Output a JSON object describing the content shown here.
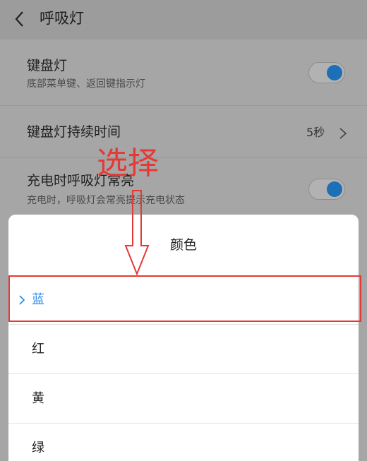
{
  "header": {
    "title": "呼吸灯"
  },
  "settings": {
    "rows": [
      {
        "title": "键盘灯",
        "subtitle": "底部菜单键、返回键指示灯",
        "toggle": true
      },
      {
        "title": "键盘灯持续时间",
        "value": "5秒"
      },
      {
        "title": "充电时呼吸灯常亮",
        "subtitle": "充电时，呼吸灯会常亮提示充电状态",
        "toggle": true
      }
    ]
  },
  "dialog": {
    "title": "颜色",
    "options": [
      {
        "label": "蓝",
        "selected": true
      },
      {
        "label": "红"
      },
      {
        "label": "黄"
      },
      {
        "label": "绿"
      }
    ]
  },
  "annotation": {
    "text": "选择"
  },
  "colors": {
    "accent": "#2b8ee8",
    "annotation": "#e53935",
    "toggle_on": "#1d6fb6"
  }
}
